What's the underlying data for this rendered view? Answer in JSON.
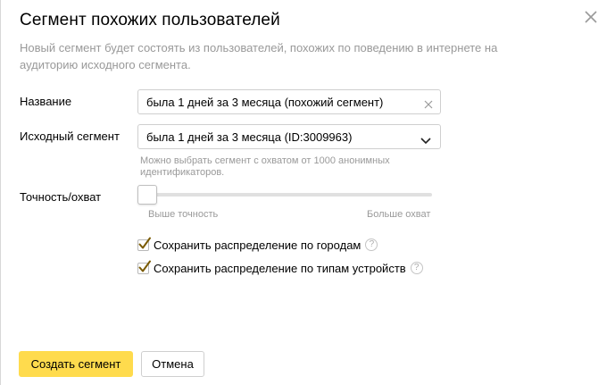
{
  "dialog": {
    "title": "Сегмент похожих пользователей",
    "description": "Новый сегмент будет состоять из пользователей, похожих по поведению в интернете на аудиторию исходного сегмента.",
    "close_icon": "close-icon"
  },
  "form": {
    "name": {
      "label": "Название",
      "value": "была 1 дней за 3 месяца (похожий сегмент)",
      "clear_icon": "clear-icon"
    },
    "source_segment": {
      "label": "Исходный сегмент",
      "value": "была 1 дней за 3 месяца (ID:3009963)",
      "hint": "Можно выбрать сегмент с охватом от 1000 анонимных идентификаторов.",
      "arrow_icon": "chevron-down-icon"
    },
    "accuracy": {
      "label": "Точность/охват",
      "left_label": "Выше точность",
      "right_label": "Больше охват",
      "level": 0
    },
    "options": [
      {
        "label": "Сохранить распределение по городам",
        "checked": true,
        "help": "?"
      },
      {
        "label": "Сохранить распределение по типам устройств",
        "checked": true,
        "help": "?"
      }
    ]
  },
  "buttons": {
    "create": "Создать сегмент",
    "cancel": "Отмена"
  },
  "colors": {
    "accent": "#ffdb4d",
    "checkmark": "#7a5a00",
    "muted_text": "#999999"
  }
}
